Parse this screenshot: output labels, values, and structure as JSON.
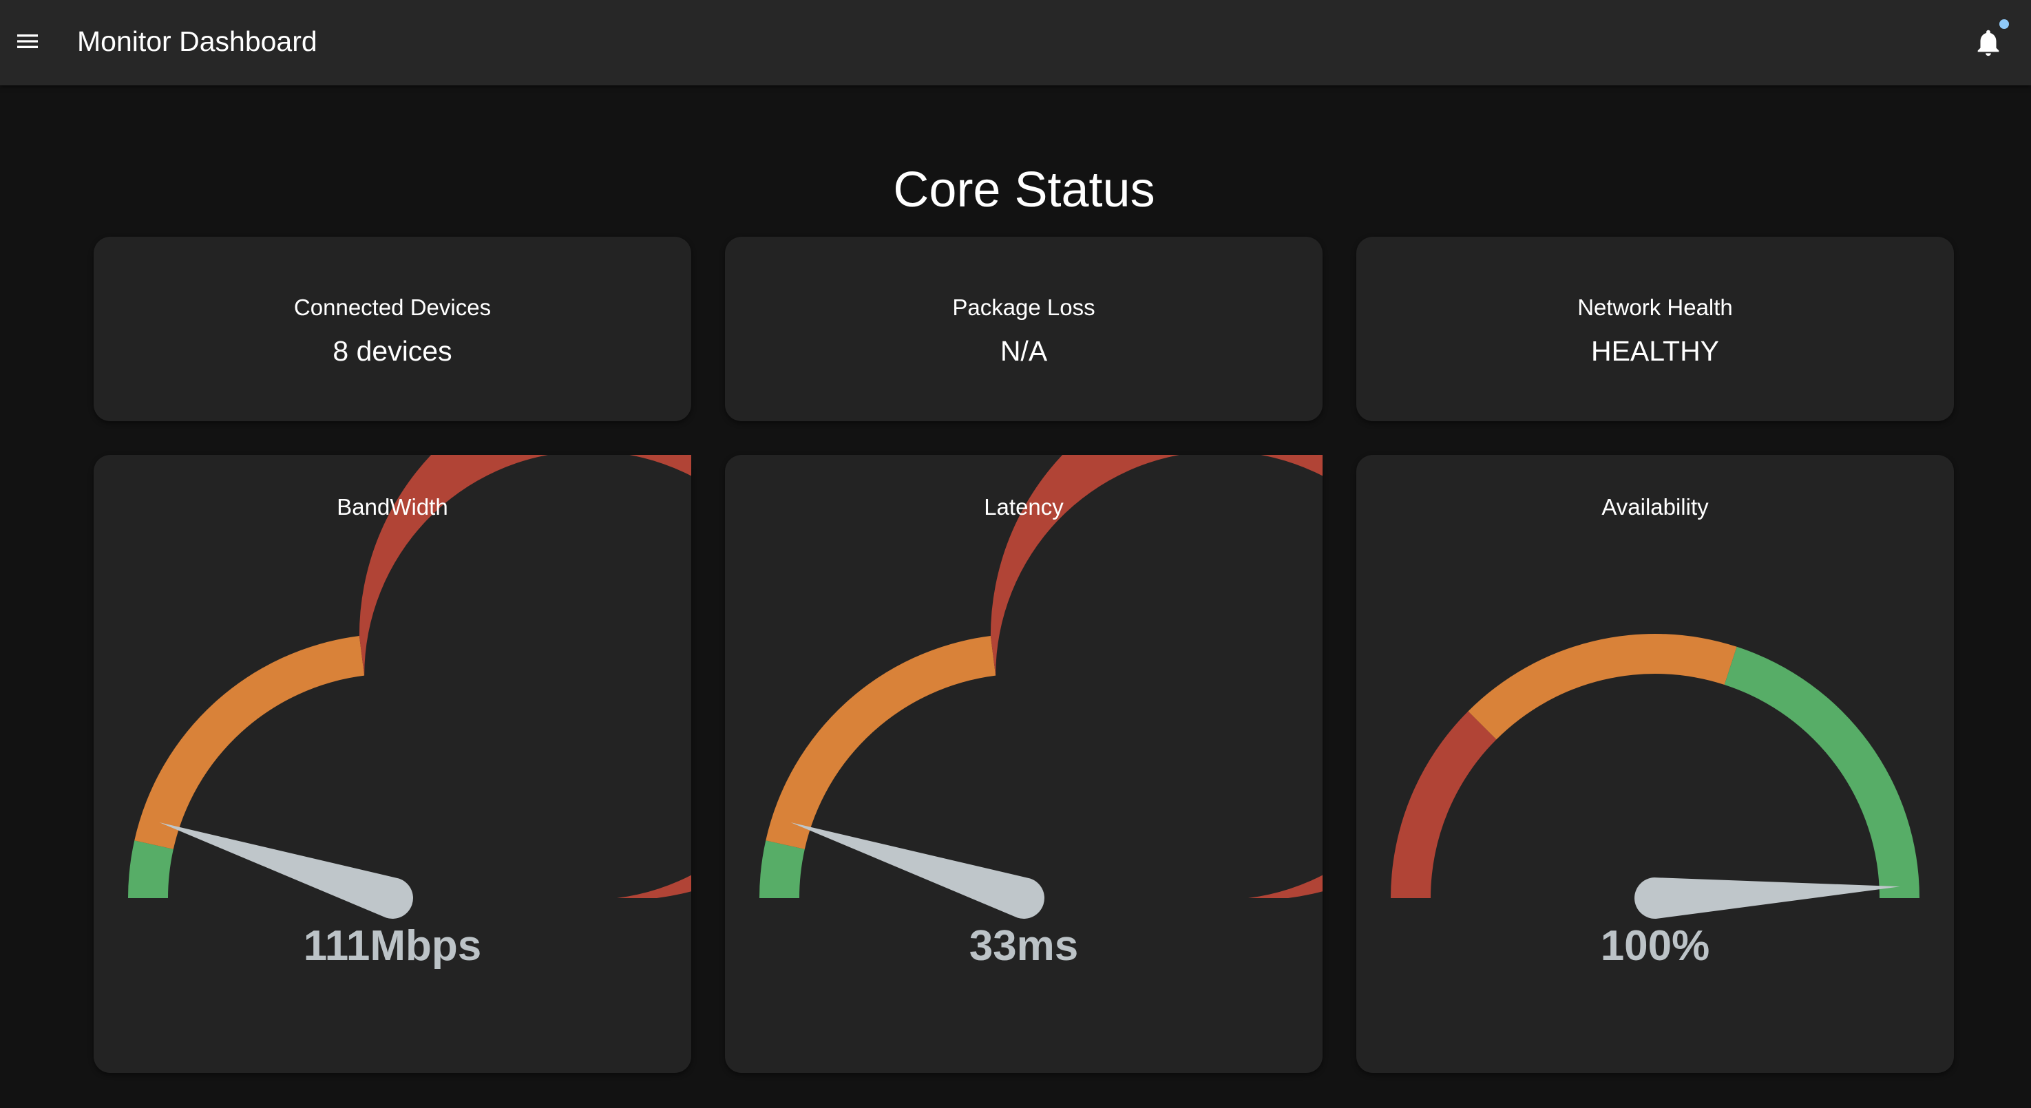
{
  "appbar": {
    "title": "Monitor Dashboard",
    "menu_icon": "menu-icon",
    "notification_icon": "bell-icon",
    "notification_dot_color": "#90caf9"
  },
  "section": {
    "title": "Core Status"
  },
  "stats": [
    {
      "label": "Connected Devices",
      "value": "8 devices"
    },
    {
      "label": "Package Loss",
      "value": "N/A"
    },
    {
      "label": "Network Health",
      "value": "HEALTHY"
    }
  ],
  "colors": {
    "green": "#57ad67",
    "orange": "#d98239",
    "red": "#b14436",
    "needle": "#bfc6ca",
    "value_text": "#bcc3c7"
  },
  "gauges": [
    {
      "label": "BandWidth",
      "value_text": "111Mbps",
      "needle_fraction": 0.1,
      "segments": [
        {
          "color": "green",
          "from": 0,
          "to": 0.07
        },
        {
          "color": "orange",
          "from": 0.07,
          "to": 0.46
        },
        {
          "color": "red",
          "from": 0.46,
          "to": 1
        }
      ]
    },
    {
      "label": "Latency",
      "value_text": "33ms",
      "needle_fraction": 0.1,
      "segments": [
        {
          "color": "green",
          "from": 0,
          "to": 0.07
        },
        {
          "color": "orange",
          "from": 0.07,
          "to": 0.46
        },
        {
          "color": "red",
          "from": 0.46,
          "to": 1
        }
      ]
    },
    {
      "label": "Availability",
      "value_text": "100%",
      "needle_fraction": 0.985,
      "segments": [
        {
          "color": "red",
          "from": 0,
          "to": 0.25
        },
        {
          "color": "orange",
          "from": 0.25,
          "to": 0.6
        },
        {
          "color": "green",
          "from": 0.6,
          "to": 1
        }
      ]
    }
  ]
}
